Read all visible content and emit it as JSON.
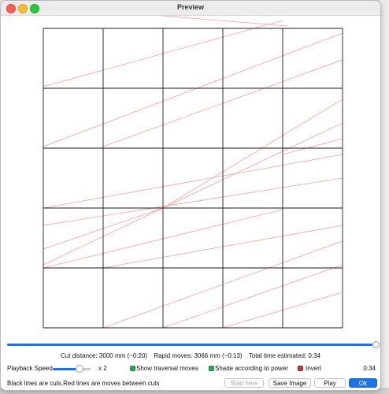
{
  "window": {
    "title": "Preview"
  },
  "stats": {
    "cut_distance": "Cut distance: 3000 mm (~0:20)",
    "rapid_moves": "Rapid moves: 3066 mm (~0:13)",
    "total_time": "Total time estimated: 0:34"
  },
  "playback": {
    "label": "Playback Speed",
    "speed": "x 2",
    "slider_fraction": 0.62,
    "progress_fraction": 1.0,
    "time": "0:34"
  },
  "options": {
    "show_traversal": {
      "label": "Show traversal moves",
      "checked": true
    },
    "shade_power": {
      "label": "Shade according to power",
      "checked": true
    },
    "invert": {
      "label": "Invert",
      "checked": false
    }
  },
  "footer": {
    "note": "Black lines are cuts,Red lines are moves between cuts",
    "start_here": "Start here",
    "save_image": "Save Image",
    "play": "Play",
    "ok": "Ok"
  },
  "colors": {
    "cut_line": "#1a1a1a",
    "rapid_line": "#f2a0a0",
    "accent": "#1a73e8"
  },
  "grid": {
    "rows": 5,
    "cols": 5
  }
}
